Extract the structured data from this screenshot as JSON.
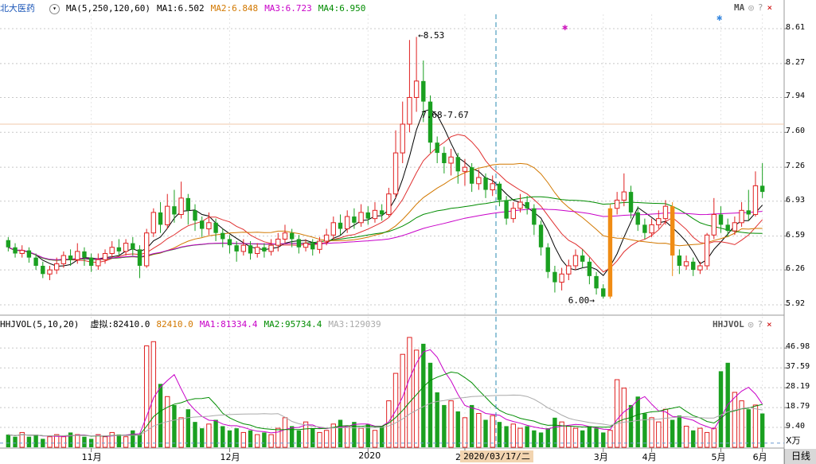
{
  "header": {
    "stock_name": "北大医药",
    "indicator": "MA(5,250,120,60)",
    "ma1": "MA1:6.502",
    "ma2": "MA2:6.848",
    "ma3": "MA3:6.723",
    "ma4": "MA4:6.950",
    "tool_label": "MA"
  },
  "vol_header": {
    "indicator": "HHJVOL(5,10,20)",
    "virtual": "虚拟:82410.0",
    "value": "82410.0",
    "ma1": "MA1:81334.4",
    "ma2": "MA2:95734.4",
    "ma3": "MA3:129039",
    "tool_label": "HHJVOL"
  },
  "tools": {
    "settings": "◎",
    "help": "?",
    "close": "×"
  },
  "price_axis": [
    "8.61",
    "8.27",
    "7.94",
    "7.60",
    "7.26",
    "6.93",
    "6.59",
    "6.26",
    "5.92"
  ],
  "volume_axis": [
    "46.98",
    "37.59",
    "28.19",
    "18.79",
    "9.40"
  ],
  "volume_unit": "X万",
  "x_axis": [
    "11月",
    "12月",
    "2020",
    "2月",
    "3月",
    "4月",
    "5月",
    "6月"
  ],
  "crosshair_date": "2020/03/17/二",
  "day_button": "日线",
  "annotations": {
    "high": "8.53",
    "low": "6.00",
    "mid": "7.68-7.67"
  },
  "colors": {
    "up": "#e02020",
    "down": "#1aa020",
    "ma1": "#000000",
    "ma2": "#d27800",
    "ma3": "#c800c8",
    "ma4": "#008c00",
    "hollow_up": "#e02020",
    "special": "#f08c14"
  },
  "chart_data": {
    "type": "candlestick",
    "price_range": [
      5.85,
      8.75
    ],
    "high_label": 8.53,
    "low_label": 6.0,
    "volume_range_wan": [
      0,
      55
    ],
    "candles": [
      [
        6.55,
        6.48,
        6.58,
        6.44
      ],
      [
        6.48,
        6.42,
        6.52,
        6.38
      ],
      [
        6.42,
        6.45,
        6.5,
        6.38
      ],
      [
        6.45,
        6.38,
        6.48,
        6.33
      ],
      [
        6.38,
        6.3,
        6.42,
        6.26
      ],
      [
        6.3,
        6.22,
        6.34,
        6.18
      ],
      [
        6.22,
        6.26,
        6.3,
        6.16
      ],
      [
        6.26,
        6.32,
        6.38,
        6.22
      ],
      [
        6.32,
        6.4,
        6.44,
        6.28
      ],
      [
        6.4,
        6.36,
        6.46,
        6.3
      ],
      [
        6.36,
        6.44,
        6.52,
        6.32
      ],
      [
        6.44,
        6.38,
        6.48,
        6.3
      ],
      [
        6.38,
        6.3,
        6.42,
        6.24
      ],
      [
        6.3,
        6.36,
        6.42,
        6.26
      ],
      [
        6.36,
        6.42,
        6.46,
        6.32
      ],
      [
        6.42,
        6.48,
        6.54,
        6.38
      ],
      [
        6.48,
        6.44,
        6.56,
        6.4
      ],
      [
        6.44,
        6.52,
        6.56,
        6.4
      ],
      [
        6.52,
        6.46,
        6.58,
        6.4
      ],
      [
        6.46,
        6.3,
        6.5,
        6.18
      ],
      [
        6.3,
        6.62,
        6.66,
        6.28
      ],
      [
        6.62,
        6.82,
        6.86,
        6.58
      ],
      [
        6.82,
        6.7,
        6.92,
        6.62
      ],
      [
        6.7,
        6.88,
        7.0,
        6.66
      ],
      [
        6.88,
        6.8,
        7.04,
        6.72
      ],
      [
        6.8,
        6.96,
        7.12,
        6.76
      ],
      [
        6.96,
        6.84,
        7.0,
        6.7
      ],
      [
        6.84,
        6.74,
        6.9,
        6.64
      ],
      [
        6.74,
        6.66,
        6.78,
        6.58
      ],
      [
        6.66,
        6.72,
        6.82,
        6.6
      ],
      [
        6.72,
        6.62,
        6.76,
        6.54
      ],
      [
        6.62,
        6.56,
        6.66,
        6.48
      ],
      [
        6.56,
        6.5,
        6.6,
        6.42
      ],
      [
        6.5,
        6.44,
        6.54,
        6.34
      ],
      [
        6.44,
        6.5,
        6.56,
        6.4
      ],
      [
        6.5,
        6.42,
        6.54,
        6.36
      ],
      [
        6.42,
        6.48,
        6.52,
        6.38
      ],
      [
        6.48,
        6.44,
        6.52,
        6.38
      ],
      [
        6.44,
        6.5,
        6.56,
        6.4
      ],
      [
        6.5,
        6.56,
        6.62,
        6.44
      ],
      [
        6.56,
        6.62,
        6.7,
        6.52
      ],
      [
        6.62,
        6.56,
        6.66,
        6.48
      ],
      [
        6.56,
        6.48,
        6.6,
        6.42
      ],
      [
        6.48,
        6.52,
        6.56,
        6.44
      ],
      [
        6.52,
        6.46,
        6.56,
        6.4
      ],
      [
        6.46,
        6.54,
        6.58,
        6.42
      ],
      [
        6.54,
        6.6,
        6.66,
        6.5
      ],
      [
        6.6,
        6.72,
        6.78,
        6.56
      ],
      [
        6.72,
        6.66,
        6.8,
        6.6
      ],
      [
        6.66,
        6.78,
        6.84,
        6.62
      ],
      [
        6.78,
        6.72,
        6.86,
        6.66
      ],
      [
        6.72,
        6.82,
        6.9,
        6.68
      ],
      [
        6.82,
        6.76,
        6.88,
        6.7
      ],
      [
        6.76,
        6.84,
        6.92,
        6.72
      ],
      [
        6.84,
        6.8,
        6.9,
        6.74
      ],
      [
        6.8,
        7.0,
        7.06,
        6.78
      ],
      [
        7.0,
        7.4,
        7.62,
        6.96
      ],
      [
        7.4,
        7.68,
        7.9,
        7.3
      ],
      [
        7.68,
        7.94,
        8.5,
        7.6
      ],
      [
        7.94,
        8.1,
        8.53,
        7.8
      ],
      [
        8.1,
        7.9,
        8.3,
        7.7
      ],
      [
        7.9,
        7.5,
        7.96,
        7.4
      ],
      [
        7.5,
        7.4,
        7.56,
        7.3
      ],
      [
        7.4,
        7.3,
        7.46,
        7.2
      ],
      [
        7.3,
        7.36,
        7.44,
        7.18
      ],
      [
        7.36,
        7.22,
        7.4,
        7.1
      ],
      [
        7.22,
        7.26,
        7.34,
        7.08
      ],
      [
        7.26,
        7.1,
        7.3,
        7.02
      ],
      [
        7.1,
        7.16,
        7.24,
        7.04
      ],
      [
        7.16,
        7.04,
        7.2,
        6.96
      ],
      [
        7.04,
        7.1,
        7.18,
        6.98
      ],
      [
        7.1,
        6.94,
        7.12,
        6.88
      ],
      [
        6.94,
        6.76,
        6.98,
        6.7
      ],
      [
        6.76,
        6.86,
        6.92,
        6.72
      ],
      [
        6.86,
        6.92,
        7.0,
        6.82
      ],
      [
        6.92,
        6.86,
        6.98,
        6.8
      ],
      [
        6.86,
        6.7,
        6.9,
        6.6
      ],
      [
        6.7,
        6.48,
        6.74,
        6.4
      ],
      [
        6.48,
        6.24,
        6.52,
        6.18
      ],
      [
        6.24,
        6.14,
        6.3,
        6.04
      ],
      [
        6.14,
        6.22,
        6.28,
        6.06
      ],
      [
        6.22,
        6.3,
        6.36,
        6.16
      ],
      [
        6.3,
        6.4,
        6.46,
        6.26
      ],
      [
        6.4,
        6.34,
        6.46,
        6.28
      ],
      [
        6.34,
        6.2,
        6.38,
        6.12
      ],
      [
        6.2,
        6.08,
        6.24,
        6.02
      ],
      [
        6.08,
        6.0,
        6.12,
        5.98
      ],
      [
        6.0,
        6.86,
        6.9,
        5.98
      ],
      [
        6.86,
        6.94,
        7.02,
        6.8
      ],
      [
        6.94,
        7.02,
        7.2,
        6.88
      ],
      [
        7.02,
        6.82,
        7.08,
        6.76
      ],
      [
        6.82,
        6.7,
        6.88,
        6.64
      ],
      [
        6.7,
        6.62,
        6.76,
        6.56
      ],
      [
        6.62,
        6.7,
        6.76,
        6.58
      ],
      [
        6.7,
        6.76,
        6.84,
        6.66
      ],
      [
        6.76,
        6.88,
        6.94,
        6.7
      ],
      [
        6.88,
        6.4,
        6.92,
        6.2
      ],
      [
        6.4,
        6.3,
        6.46,
        6.22
      ],
      [
        6.3,
        6.34,
        6.4,
        6.26
      ],
      [
        6.34,
        6.26,
        6.38,
        6.2
      ],
      [
        6.26,
        6.3,
        6.34,
        6.22
      ],
      [
        6.3,
        6.6,
        6.62,
        6.26
      ],
      [
        6.6,
        6.8,
        6.96,
        6.56
      ],
      [
        6.8,
        6.7,
        6.88,
        6.62
      ],
      [
        6.7,
        6.64,
        6.76,
        6.58
      ],
      [
        6.64,
        6.72,
        6.78,
        6.6
      ],
      [
        6.72,
        6.84,
        6.92,
        6.68
      ],
      [
        6.84,
        6.8,
        7.04,
        6.74
      ],
      [
        6.8,
        7.08,
        7.22,
        6.78
      ],
      [
        7.08,
        7.02,
        7.3,
        6.96
      ]
    ],
    "volumes_wan": [
      6,
      5,
      7,
      5,
      6,
      4,
      5,
      6,
      5,
      7,
      6,
      5,
      4,
      6,
      5,
      7,
      6,
      5,
      8,
      6,
      48,
      50,
      30,
      24,
      20,
      14,
      18,
      12,
      9,
      11,
      13,
      10,
      8,
      9,
      7,
      8,
      6,
      7,
      6,
      9,
      14,
      10,
      8,
      12,
      9,
      7,
      8,
      11,
      13,
      10,
      12,
      9,
      11,
      8,
      10,
      22,
      35,
      44,
      52,
      46,
      49,
      40,
      26,
      20,
      22,
      17,
      14,
      20,
      16,
      13,
      15,
      12,
      10,
      11,
      9,
      10,
      8,
      7,
      9,
      14,
      12,
      10,
      9,
      8,
      10,
      9,
      7,
      8,
      32,
      28,
      20,
      24,
      16,
      14,
      12,
      18,
      13,
      15,
      10,
      8,
      9,
      7,
      9,
      36,
      40,
      26,
      22,
      18,
      20,
      16,
      22,
      20
    ],
    "ma_series": {
      "ma1": "5-day average of close",
      "ma2": "250-day average",
      "ma3": "120-day average",
      "ma4": "60-day average"
    }
  }
}
